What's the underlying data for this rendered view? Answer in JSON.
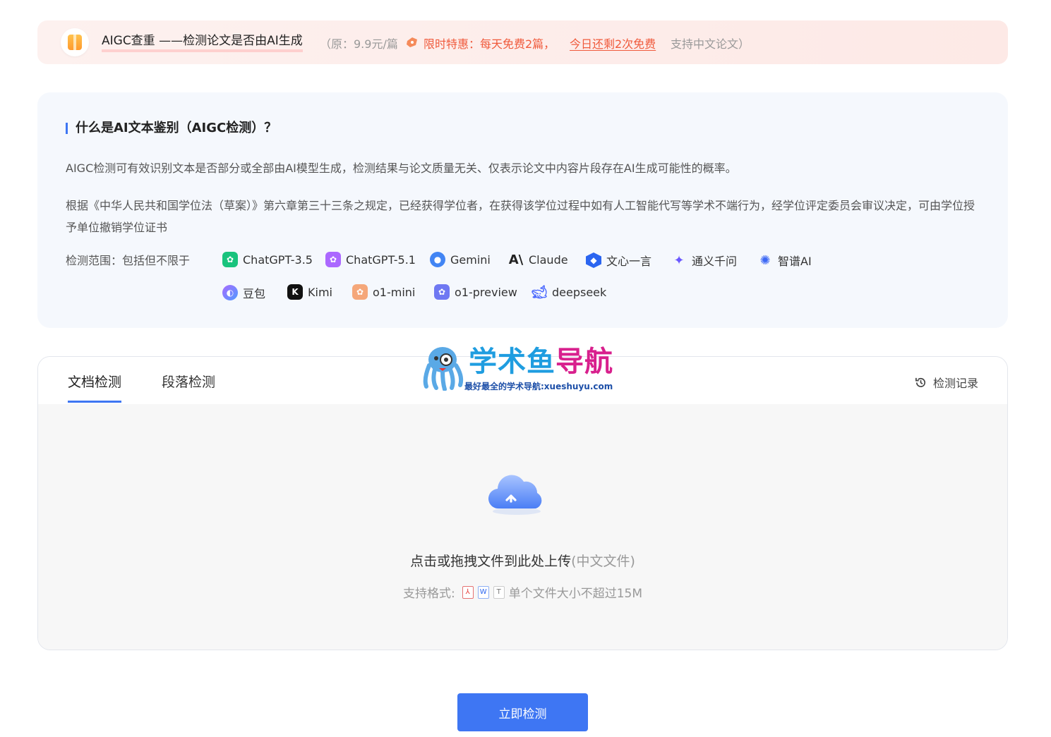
{
  "banner": {
    "title": "AIGC查重 ——检测论文是否由AI生成",
    "price": "（原：9.9元/篇",
    "promo": "限时特惠：每天免费2篇，",
    "remaining_link": "今日还剩2次免费",
    "support": "支持中文论文）"
  },
  "info": {
    "title": "什么是AI文本鉴别（AIGC检测）？",
    "paragraph1": "AIGC检测可有效识别文本是否部分或全部由AI模型生成，检测结果与论文质量无关、仅表示论文中内容片段存在AI生成可能性的概率。",
    "paragraph2": "根据《中华人民共和国学位法（草案）》第六章第三十三条之规定，已经获得学位者，在获得该学位过程中如有人工智能代写等学术不端行为，经学位评定委员会审议决定，可由学位授予单位撤销学位证书",
    "scope_label": "检测范围：包括但不限于",
    "models": [
      {
        "name": "ChatGPT-3.5",
        "icon": "chatgpt-green-icon",
        "color": "#19c37d"
      },
      {
        "name": "ChatGPT-5.1",
        "icon": "chatgpt-purple-icon",
        "color": "#ab68ff"
      },
      {
        "name": "Gemini",
        "icon": "gemini-icon",
        "color": "#4285f4"
      },
      {
        "name": "Claude",
        "icon": "claude-icon",
        "color": "#222222"
      },
      {
        "name": "文心一言",
        "icon": "wenxin-icon",
        "color": "#2b65f0"
      },
      {
        "name": "通义千问",
        "icon": "tongyi-icon",
        "color": "#6b58ff"
      },
      {
        "name": "智谱AI",
        "icon": "zhipu-icon",
        "color": "#3b67f5"
      },
      {
        "name": "豆包",
        "icon": "doubao-icon",
        "color": "#6a8cff"
      },
      {
        "name": "Kimi",
        "icon": "kimi-icon",
        "color": "#111111"
      },
      {
        "name": "o1-mini",
        "icon": "o1-mini-icon",
        "color": "#f5a77a"
      },
      {
        "name": "o1-preview",
        "icon": "o1-preview-icon",
        "color": "#6f78f2"
      },
      {
        "name": "deepseek",
        "icon": "deepseek-icon",
        "color": "#4d6bfe"
      }
    ]
  },
  "watermark": {
    "title_blue": "学术鱼",
    "title_pink": "导航",
    "subtitle": "最好最全的学术导航:xueshuyu.com"
  },
  "upload": {
    "tabs": [
      "文档检测",
      "段落检测"
    ],
    "active_tab": 0,
    "history_label": "检测记录",
    "drop_text": "点击或拖拽文件到此处上传",
    "drop_note": "(中文文件)",
    "formats_label": "支持格式:",
    "format_icons": [
      "pdf-icon",
      "word-icon",
      "txt-icon"
    ],
    "size_note": "单个文件大小不超过15M"
  },
  "submit_label": "立即检测",
  "colors": {
    "primary": "#3e76f3",
    "promo": "#f05a3c",
    "banner_bg": "#fdeeeb",
    "info_bg": "#f5f8fd"
  }
}
